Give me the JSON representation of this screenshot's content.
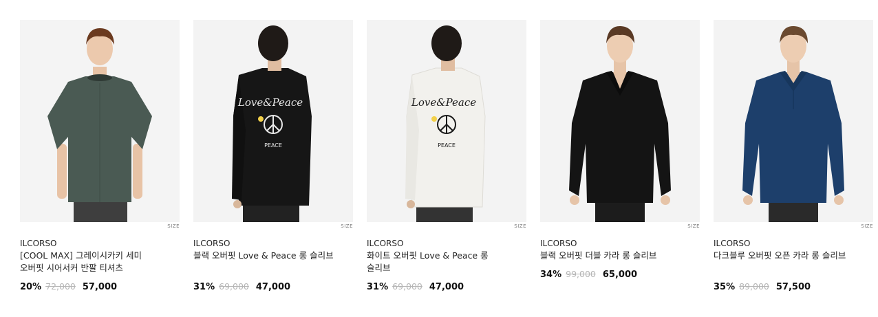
{
  "size_label": "SIZE",
  "products": [
    {
      "brand": "ILCORSO",
      "name": "[COOL MAX] 그레이시카키 세미 오버핏 시어서커 반팔 티셔츠",
      "discount": "20%",
      "original_price": "72,000",
      "price": "57,000",
      "colors": {
        "garment": "#4a5a53",
        "bg": "#f4f4f4",
        "hair": "#6b3a1f"
      }
    },
    {
      "brand": "ILCORSO",
      "name": "블랙 오버핏 Love & Peace 롱 슬리브",
      "discount": "31%",
      "original_price": "69,000",
      "price": "47,000",
      "colors": {
        "garment": "#161616",
        "bg": "#f3f3f3",
        "hair": "#1f1a17"
      }
    },
    {
      "brand": "ILCORSO",
      "name": "화이트 오버핏 Love & Peace 롱 슬리브",
      "discount": "31%",
      "original_price": "69,000",
      "price": "47,000",
      "colors": {
        "garment": "#f2f1ed",
        "bg": "#f3f3f3",
        "hair": "#1f1a17"
      }
    },
    {
      "brand": "ILCORSO",
      "name": "블랙 오버핏 더블 카라 롱 슬리브",
      "discount": "34%",
      "original_price": "99,000",
      "price": "65,000",
      "colors": {
        "garment": "#141414",
        "bg": "#f3f3f3",
        "hair": "#5a3a25"
      }
    },
    {
      "brand": "ILCORSO",
      "name": "다크블루 오버핏 오픈 카라 롱 슬리브",
      "discount": "35%",
      "original_price": "89,000",
      "price": "57,500",
      "colors": {
        "garment": "#1d3f6b",
        "bg": "#f3f3f3",
        "hair": "#6b4a30"
      }
    }
  ]
}
